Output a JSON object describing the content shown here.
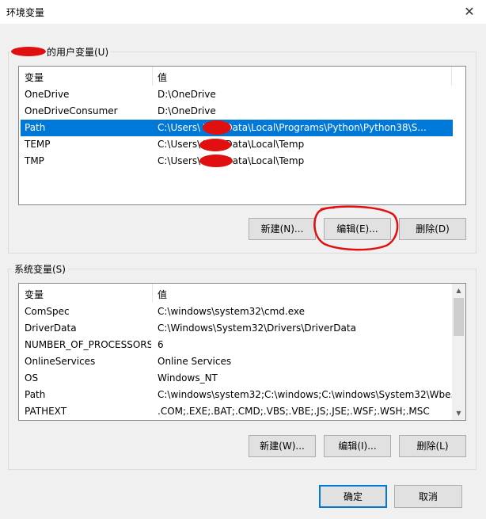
{
  "window": {
    "title": "环境变量",
    "close_glyph": "✕"
  },
  "user_vars": {
    "label_suffix": "的用户变量(U)",
    "header": {
      "name": "变量",
      "value": "值"
    },
    "rows": [
      {
        "name": "OneDrive",
        "value": "D:\\OneDrive"
      },
      {
        "name": "OneDriveConsumer",
        "value": "D:\\OneDrive"
      },
      {
        "name": "Path",
        "value": "C:\\Users\\       \\AppData\\Local\\Programs\\Python\\Python38\\S..."
      },
      {
        "name": "TEMP",
        "value": "C:\\Users\\       \\AppData\\Local\\Temp"
      },
      {
        "name": "TMP",
        "value": "C:\\Users\\       \\AppData\\Local\\Temp"
      }
    ],
    "buttons": {
      "new": "新建(N)...",
      "edit": "编辑(E)...",
      "delete": "删除(D)"
    }
  },
  "system_vars": {
    "label": "系统变量(S)",
    "header": {
      "name": "变量",
      "value": "值"
    },
    "rows": [
      {
        "name": "ComSpec",
        "value": "C:\\windows\\system32\\cmd.exe"
      },
      {
        "name": "DriverData",
        "value": "C:\\Windows\\System32\\Drivers\\DriverData"
      },
      {
        "name": "NUMBER_OF_PROCESSORS",
        "value": "6"
      },
      {
        "name": "OnlineServices",
        "value": "Online Services"
      },
      {
        "name": "OS",
        "value": "Windows_NT"
      },
      {
        "name": "Path",
        "value": "C:\\windows\\system32;C:\\windows;C:\\windows\\System32\\Wbe..."
      },
      {
        "name": "PATHEXT",
        "value": ".COM;.EXE;.BAT;.CMD;.VBS;.VBE;.JS;.JSE;.WSF;.WSH;.MSC"
      }
    ],
    "buttons": {
      "new": "新建(W)...",
      "edit": "编辑(I)...",
      "delete": "删除(L)"
    }
  },
  "dialog_buttons": {
    "ok": "确定",
    "cancel": "取消"
  },
  "colors": {
    "selection": "#0078d7",
    "annotation": "#e01010"
  }
}
